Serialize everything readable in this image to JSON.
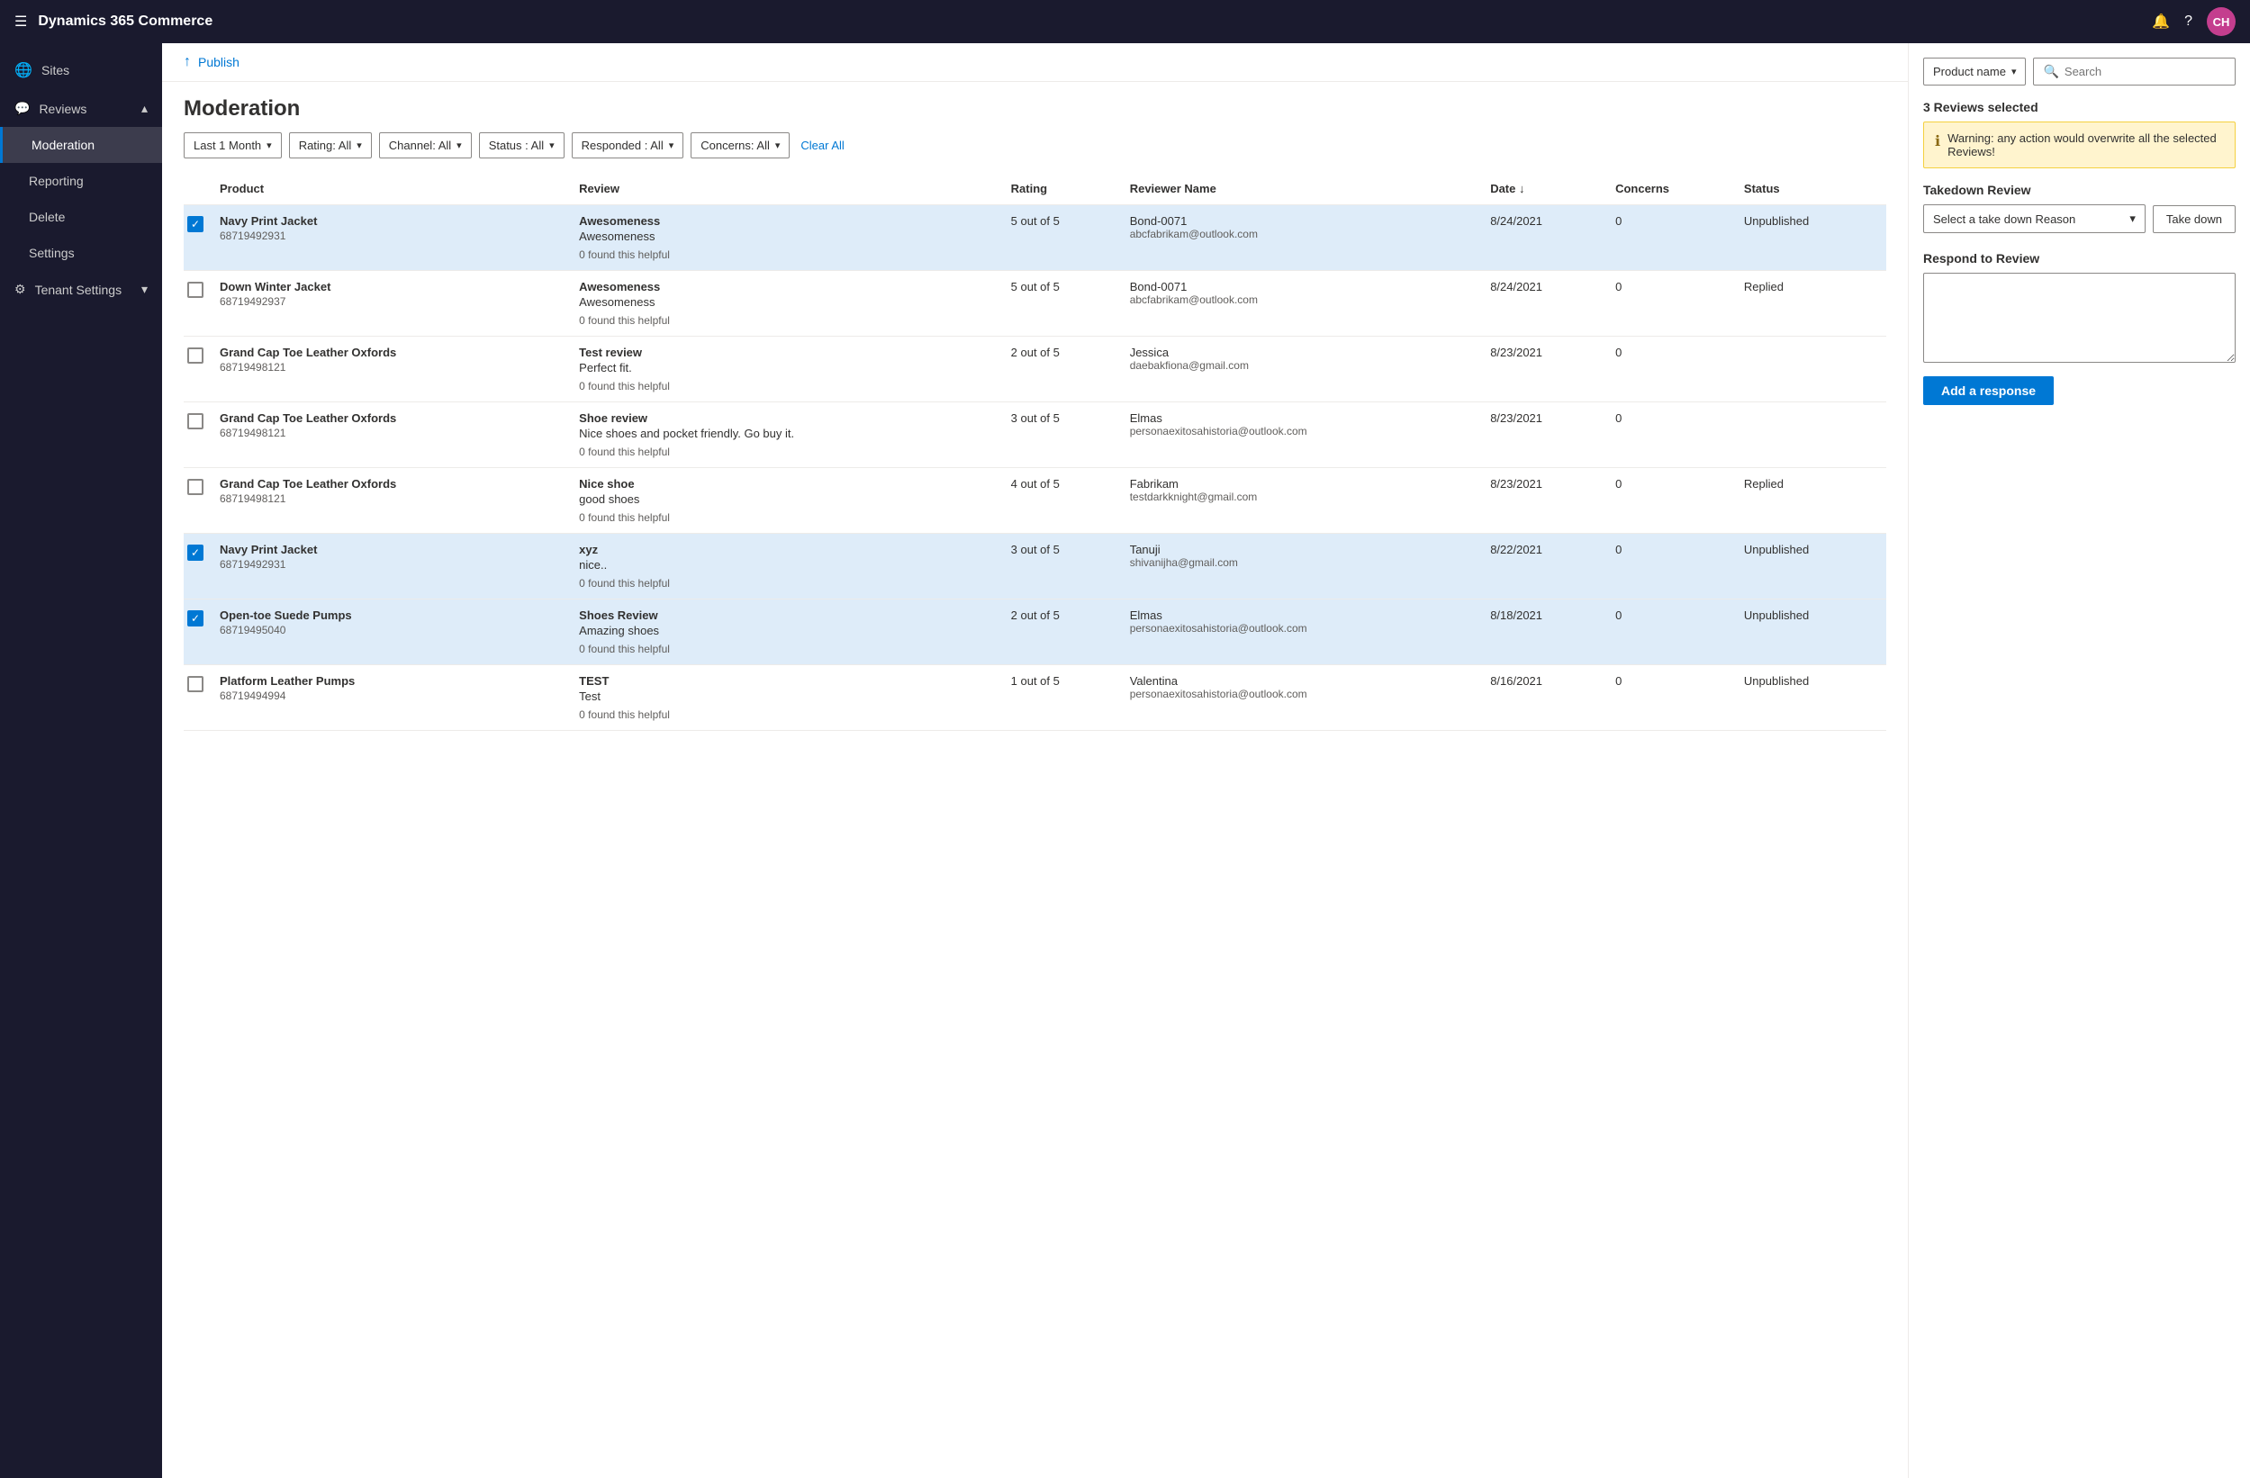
{
  "app": {
    "title": "Dynamics 365 Commerce",
    "user_initials": "CH",
    "user_avatar_color": "#c43e8e"
  },
  "sidebar": {
    "hamburger_icon": "☰",
    "items": [
      {
        "id": "sites",
        "label": "Sites",
        "icon": "🌐"
      },
      {
        "id": "reviews",
        "label": "Reviews",
        "icon": "💬",
        "expandable": true,
        "expanded": true
      },
      {
        "id": "moderation",
        "label": "Moderation",
        "icon": "",
        "active": true
      },
      {
        "id": "reporting",
        "label": "Reporting",
        "icon": ""
      },
      {
        "id": "delete",
        "label": "Delete",
        "icon": ""
      },
      {
        "id": "settings",
        "label": "Settings",
        "icon": ""
      },
      {
        "id": "tenant-settings",
        "label": "Tenant Settings",
        "icon": "⚙",
        "expandable": true
      }
    ]
  },
  "publish": {
    "label": "Publish",
    "icon": "↑"
  },
  "page": {
    "title": "Moderation"
  },
  "filters": {
    "date": {
      "label": "Last 1 Month",
      "value": "Last 1 Month"
    },
    "rating": {
      "label": "Rating: All",
      "value": "Rating: All"
    },
    "channel": {
      "label": "Channel: All",
      "value": "Channel: All"
    },
    "status": {
      "label": "Status : All",
      "value": "Status : All"
    },
    "responded": {
      "label": "Responded : All",
      "value": "Responded : All"
    },
    "concerns": {
      "label": "Concerns: All",
      "value": "Concerns: All"
    },
    "clear_all": "Clear All"
  },
  "table": {
    "columns": [
      "",
      "Product",
      "Review",
      "Rating",
      "Reviewer Name",
      "Date",
      "Concerns",
      "Status"
    ],
    "rows": [
      {
        "selected": true,
        "product_name": "Navy Print Jacket",
        "product_id": "68719492931",
        "review_title": "Awesomeness",
        "review_body": "Awesomeness",
        "found_helpful": "0 found this helpful",
        "rating": "5 out of 5",
        "reviewer_name": "Bond-0071",
        "reviewer_email": "abcfabrikam@outlook.com",
        "date": "8/24/2021",
        "concerns": "0",
        "status": "Unpublished"
      },
      {
        "selected": false,
        "product_name": "Down Winter Jacket",
        "product_id": "68719492937",
        "review_title": "Awesomeness",
        "review_body": "Awesomeness",
        "found_helpful": "0 found this helpful",
        "rating": "5 out of 5",
        "reviewer_name": "Bond-0071",
        "reviewer_email": "abcfabrikam@outlook.com",
        "date": "8/24/2021",
        "concerns": "0",
        "status": "Replied"
      },
      {
        "selected": false,
        "product_name": "Grand Cap Toe Leather Oxfords",
        "product_id": "68719498121",
        "review_title": "Test review",
        "review_body": "Perfect fit.",
        "found_helpful": "0 found this helpful",
        "rating": "2 out of 5",
        "reviewer_name": "Jessica",
        "reviewer_email": "daebakfiona@gmail.com",
        "date": "8/23/2021",
        "concerns": "0",
        "status": ""
      },
      {
        "selected": false,
        "product_name": "Grand Cap Toe Leather Oxfords",
        "product_id": "68719498121",
        "review_title": "Shoe review",
        "review_body": "Nice shoes and pocket friendly. Go buy it.",
        "found_helpful": "0 found this helpful",
        "rating": "3 out of 5",
        "reviewer_name": "Elmas",
        "reviewer_email": "personaexitosahistoria@outlook.com",
        "date": "8/23/2021",
        "concerns": "0",
        "status": ""
      },
      {
        "selected": false,
        "product_name": "Grand Cap Toe Leather Oxfords",
        "product_id": "68719498121",
        "review_title": "Nice shoe",
        "review_body": "good shoes",
        "found_helpful": "0 found this helpful",
        "rating": "4 out of 5",
        "reviewer_name": "Fabrikam",
        "reviewer_email": "testdarkknight@gmail.com",
        "date": "8/23/2021",
        "concerns": "0",
        "status": "Replied"
      },
      {
        "selected": true,
        "product_name": "Navy Print Jacket",
        "product_id": "68719492931",
        "review_title": "xyz",
        "review_body": "nice..",
        "found_helpful": "0 found this helpful",
        "rating": "3 out of 5",
        "reviewer_name": "Tanuji",
        "reviewer_email": "shivanijha@gmail.com",
        "date": "8/22/2021",
        "concerns": "0",
        "status": "Unpublished"
      },
      {
        "selected": true,
        "product_name": "Open-toe Suede Pumps",
        "product_id": "68719495040",
        "review_title": "Shoes Review",
        "review_body": "Amazing shoes",
        "found_helpful": "0 found this helpful",
        "rating": "2 out of 5",
        "reviewer_name": "Elmas",
        "reviewer_email": "personaexitosahistoria@outlook.com",
        "date": "8/18/2021",
        "concerns": "0",
        "status": "Unpublished"
      },
      {
        "selected": false,
        "product_name": "Platform Leather Pumps",
        "product_id": "68719494994",
        "review_title": "TEST",
        "review_body": "Test",
        "found_helpful": "0 found this helpful",
        "rating": "1 out of 5",
        "reviewer_name": "Valentina",
        "reviewer_email": "personaexitosahistoria@outlook.com",
        "date": "8/16/2021",
        "concerns": "0",
        "status": "Unpublished"
      }
    ]
  },
  "right_panel": {
    "product_filter_label": "Product name",
    "search_placeholder": "Search",
    "search_icon": "🔍",
    "selected_count_label": "3 Reviews selected",
    "warning_text": "Warning: any action would overwrite all the selected Reviews!",
    "takedown_section_title": "Takedown Review",
    "takedown_placeholder": "Select a take down Reason",
    "takedown_button": "Take down",
    "respond_section_title": "Respond to Review",
    "respond_placeholder": "",
    "add_response_button": "Add a response"
  }
}
